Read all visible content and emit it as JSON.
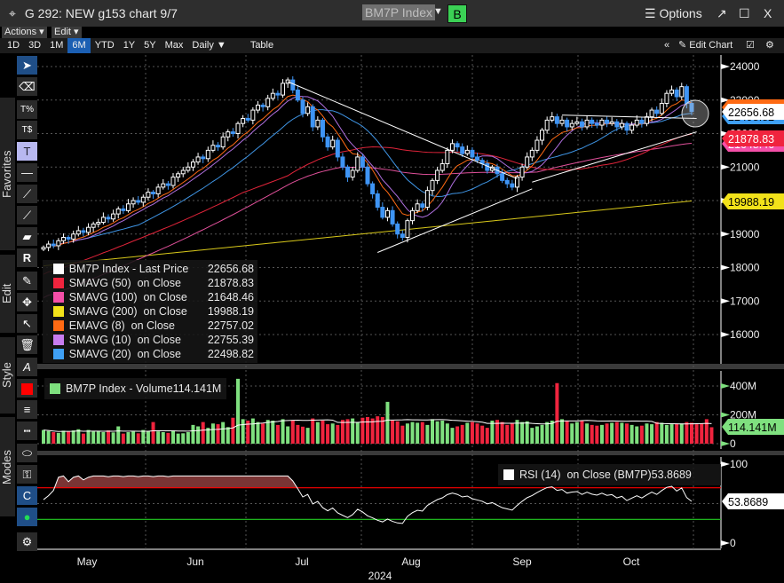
{
  "window": {
    "title": "G 292: NEW g153 chart 9/7",
    "ticker": "BM7P Index",
    "b_button": "B",
    "options": "Options",
    "popout": "↗",
    "maximize": "☐",
    "close": "X"
  },
  "menus": {
    "actions": "Actions ▾",
    "edit": "Edit ▾"
  },
  "ranges": [
    {
      "label": "1D"
    },
    {
      "label": "3D"
    },
    {
      "label": "1M"
    },
    {
      "label": "6M",
      "active": true
    },
    {
      "label": "YTD"
    },
    {
      "label": "1Y"
    },
    {
      "label": "5Y"
    },
    {
      "label": "Max"
    },
    {
      "label": "Daily ▼"
    },
    {
      "label": "Table"
    }
  ],
  "right_tools": {
    "collapse": "«",
    "edit_chart": "Edit Chart"
  },
  "toolbar": {
    "favorites": "Favorites",
    "edit": "Edit",
    "style": "Style",
    "modes": "Modes"
  },
  "legend": [
    {
      "label": "BM7P Index - Last Price",
      "value": "22656.68",
      "color": "#ffffff"
    },
    {
      "label": "SMAVG (50)  on Close",
      "value": "21878.83",
      "color": "#f0243e"
    },
    {
      "label": "SMAVG (100)  on Close",
      "value": "21648.46",
      "color": "#f54fa8"
    },
    {
      "label": "SMAVG (200)  on Close",
      "value": "19988.19",
      "color": "#f2e21a"
    },
    {
      "label": "EMAVG (8)  on Close",
      "value": "22757.02",
      "color": "#ff6a13"
    },
    {
      "label": "SMAVG (10)  on Close",
      "value": "22755.39",
      "color": "#c77cf0"
    },
    {
      "label": "SMAVG (20)  on Close",
      "value": "22498.82",
      "color": "#3fa0f5"
    }
  ],
  "volume_legend": {
    "label": "BM7P Index - Volume",
    "value": "114.141M",
    "color": "#7fe07f"
  },
  "rsi_legend": {
    "label": "RSI (14)  on Close (BM7P)",
    "value": "53.8689"
  },
  "chart_data": {
    "type": "candlestick",
    "year_label": "2024",
    "months": [
      "May",
      "Jun",
      "Jul",
      "Aug",
      "Sep",
      "Oct"
    ],
    "price_ticks": [
      "24000",
      "23000",
      "22000",
      "21000",
      "20000",
      "19000",
      "18000",
      "17000",
      "16000"
    ],
    "price_ylim": [
      15600,
      24400
    ],
    "volume_ticks": [
      "400M",
      "200M",
      "0"
    ],
    "rsi_ticks": [
      "100",
      "0"
    ],
    "rsi_levels": [
      70,
      30
    ],
    "close": [
      18600,
      18700,
      18650,
      18800,
      18900,
      18850,
      19000,
      19100,
      19050,
      19200,
      19300,
      19350,
      19500,
      19450,
      19600,
      19750,
      19700,
      19900,
      20000,
      19950,
      20100,
      20250,
      20200,
      20400,
      20500,
      20450,
      20700,
      20800,
      20900,
      21000,
      21150,
      21300,
      21250,
      21500,
      21650,
      21600,
      21900,
      22050,
      22000,
      22300,
      22450,
      22400,
      22700,
      22850,
      22800,
      23050,
      23200,
      23150,
      23500,
      23600,
      23300,
      23000,
      22600,
      22800,
      22200,
      22400,
      21900,
      21600,
      21800,
      21300,
      21000,
      20700,
      20900,
      21300,
      21000,
      20500,
      20200,
      19800,
      19500,
      19700,
      19300,
      19000,
      18900,
      19400,
      19700,
      19900,
      19800,
      20300,
      20600,
      20900,
      21100,
      21500,
      21700,
      21600,
      21400,
      21500,
      21300,
      21200,
      21100,
      20900,
      21000,
      20800,
      20600,
      20500,
      20400,
      20700,
      21000,
      21300,
      21500,
      21800,
      22100,
      22400,
      22500,
      22300,
      22400,
      22200,
      22300,
      22350,
      22200,
      22400,
      22300,
      22250,
      22400,
      22300,
      22350,
      22200,
      22300,
      22100,
      22250,
      22400,
      22300,
      22500,
      22700,
      22600,
      22900,
      23200,
      23300,
      23100,
      23400,
      22900,
      22656.68
    ],
    "volume_m": [
      95,
      88,
      80,
      75,
      90,
      85,
      92,
      100,
      70,
      95,
      85,
      88,
      80,
      92,
      78,
      120,
      70,
      80,
      85,
      72,
      95,
      88,
      150,
      85,
      80,
      75,
      92,
      70,
      72,
      80,
      130,
      120,
      150,
      110,
      140,
      135,
      150,
      115,
      180,
      450,
      170,
      160,
      175,
      150,
      140,
      165,
      160,
      130,
      170,
      120,
      160,
      130,
      118,
      110,
      175,
      150,
      160,
      135,
      140,
      130,
      165,
      170,
      175,
      150,
      180,
      185,
      175,
      190,
      185,
      290,
      160,
      155,
      125,
      140,
      150,
      145,
      150,
      130,
      170,
      155,
      160,
      140,
      110,
      120,
      130,
      145,
      150,
      140,
      125,
      110,
      160,
      165,
      150,
      130,
      140,
      165,
      150,
      155,
      110,
      120,
      130,
      150,
      160,
      420,
      170,
      160,
      140,
      150,
      160,
      140,
      130,
      125,
      130,
      140,
      145,
      150,
      145,
      140,
      130,
      120,
      125,
      140,
      135,
      150,
      145,
      130,
      135,
      140,
      140,
      150,
      145,
      135,
      140,
      170,
      114.141
    ],
    "sma200": [
      18050,
      19988.19
    ],
    "trendlines": [
      {
        "from": [
          49,
          23550
        ],
        "to": [
          95,
          20650
        ]
      },
      {
        "from": [
          67,
          18450
        ],
        "to": [
          98,
          20350
        ]
      },
      {
        "from": [
          98,
          20550
        ],
        "to": [
          131,
          22050
        ]
      },
      {
        "from": [
          104,
          22550
        ],
        "to": [
          131,
          22450
        ]
      }
    ]
  }
}
